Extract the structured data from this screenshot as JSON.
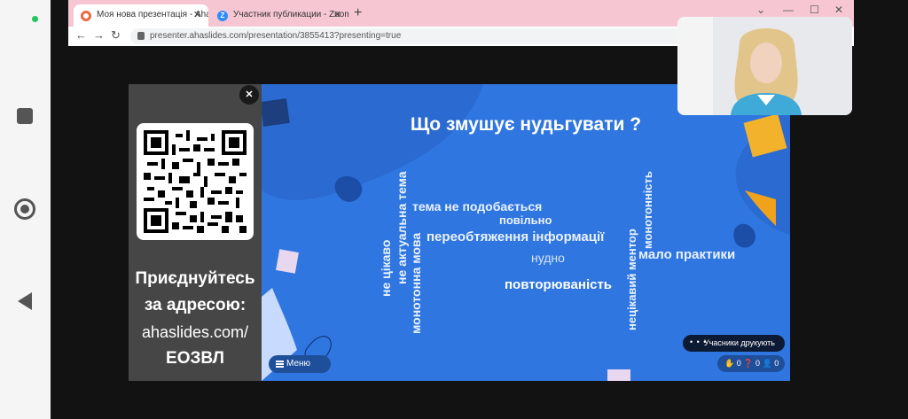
{
  "browser": {
    "tabs": [
      {
        "label": "Моя нова презентація - AhaSlid",
        "close": "✕"
      },
      {
        "label": "Участник публикации - Zoom",
        "close": "✕"
      }
    ],
    "new_tab": "+",
    "url": "presenter.ahaslides.com/presentation/3855413?presenting=true",
    "nav": {
      "back": "←",
      "forward": "→",
      "reload": "↻"
    },
    "window_controls": {
      "minimize": "—",
      "maximize": "☐",
      "close": "✕",
      "expand": "⌄"
    }
  },
  "join_panel": {
    "line1": "Приєднуйтесь",
    "line2": "за адресою:",
    "url": "ahaslides.com/",
    "code": "ЕОЗВЛ",
    "close": "✕"
  },
  "slide": {
    "title": "Що змушує нудьгувати ?",
    "words": {
      "ne_tsikavo": "не цікаво",
      "ne_aktualna_tema": "не актуальна тема",
      "monotonna_mova": "монотонна мова",
      "tema_ne_podobaetsya": "тема не подобається",
      "povilno": "повільно",
      "perevantazhennya": "переобтяження інформації",
      "nudno": "нудно",
      "povtoryuvanist": "повторюваність",
      "netsikavyi_mentor": "нецікавий ментор",
      "monotonnist": "монотонність",
      "malo_praktyky": "мало практики"
    }
  },
  "controls": {
    "menu_label": "Меню",
    "typing_label": "Учасники друкують",
    "typing_dots": "• • •",
    "stats": {
      "reactions": "0",
      "questions": "0",
      "participants": "0"
    }
  },
  "colors": {
    "slide_bg": "#2f76e0",
    "panel_bg": "#464646",
    "tab_bar": "#f6c7d2"
  }
}
